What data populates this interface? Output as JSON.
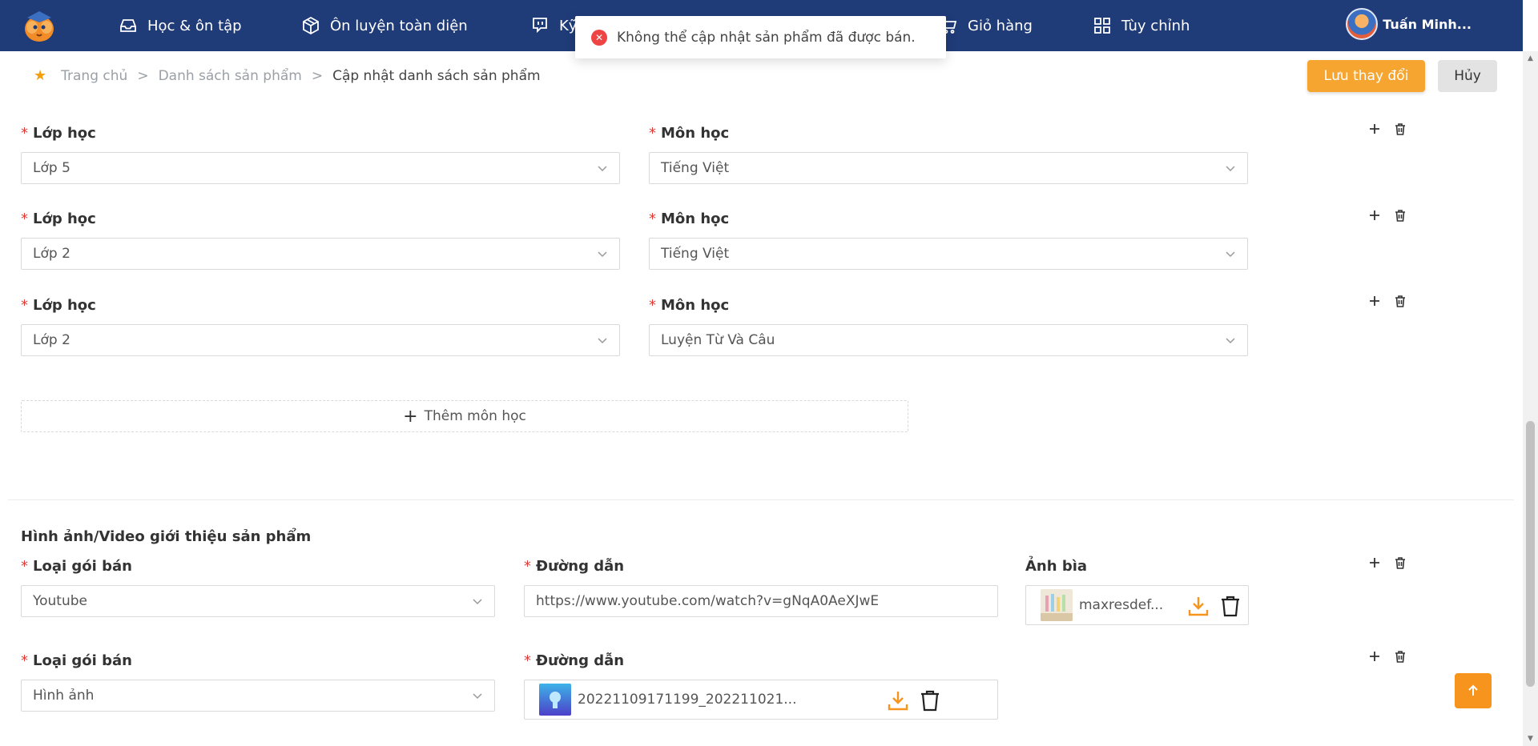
{
  "nav": {
    "items": [
      {
        "label": "Học & ôn tập",
        "icon": "inbox-icon"
      },
      {
        "label": "Ôn luyện toàn diện",
        "icon": "package-icon"
      },
      {
        "label": "Kỹ",
        "icon": "chat-icon"
      },
      {
        "label": "Giỏ hàng",
        "icon": "cart-icon"
      },
      {
        "label": "Tùy chỉnh",
        "icon": "grid-icon"
      }
    ],
    "user_name": "Tuấn Minh..."
  },
  "toast": {
    "message": "Không thể cập nhật sản phẩm đã được bán.",
    "type": "error"
  },
  "breadcrumb": {
    "items": [
      "Trang chủ",
      "Danh sách sản phẩm",
      "Cập nhật danh sách sản phẩm"
    ],
    "separator": ">"
  },
  "actions": {
    "save_label": "Lưu thay đổi",
    "cancel_label": "Hủy"
  },
  "subjects": {
    "class_label": "Lớp học",
    "subject_label": "Môn học",
    "rows": [
      {
        "class": "Lớp 5",
        "subject": "Tiếng Việt"
      },
      {
        "class": "Lớp 2",
        "subject": "Tiếng Việt"
      },
      {
        "class": "Lớp 2",
        "subject": "Luyện Từ Và Câu"
      }
    ],
    "add_label": "Thêm môn học"
  },
  "media": {
    "section_title": "Hình ảnh/Video giới thiệu sản phẩm",
    "type_label": "Loại gói bán",
    "link_label": "Đường dẫn",
    "cover_label": "Ảnh bìa",
    "rows": [
      {
        "type": "Youtube",
        "link": "https://www.youtube.com/watch?v=gNqA0AeXJwE",
        "cover_file": "maxresdef..."
      },
      {
        "type": "Hình ảnh",
        "file": "20221109171199_202211021..."
      }
    ]
  },
  "colors": {
    "nav_bg": "#1f3b78",
    "accent": "#f7a531",
    "required": "#e53935",
    "error": "#ef4444"
  }
}
